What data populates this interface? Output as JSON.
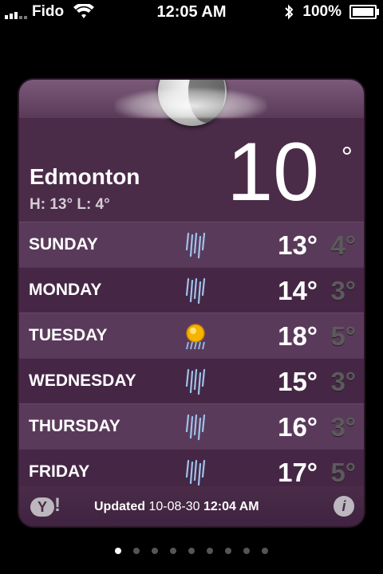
{
  "statusbar": {
    "carrier": "Fido",
    "time": "12:05 AM",
    "battery_percent": "100%",
    "battery_level": 1.0
  },
  "weather": {
    "city": "Edmonton",
    "current_temp": "10",
    "degree_symbol": "°",
    "hilo": "H: 13° L: 4°",
    "condition_icon": "moon-cloud-icon"
  },
  "forecast": [
    {
      "day": "SUNDAY",
      "icon": "rain-icon",
      "high": "13°",
      "low": "4°"
    },
    {
      "day": "MONDAY",
      "icon": "rain-icon",
      "high": "14°",
      "low": "3°"
    },
    {
      "day": "TUESDAY",
      "icon": "sun-rain-icon",
      "high": "18°",
      "low": "5°"
    },
    {
      "day": "WEDNESDAY",
      "icon": "rain-icon",
      "high": "15°",
      "low": "3°"
    },
    {
      "day": "THURSDAY",
      "icon": "rain-icon",
      "high": "16°",
      "low": "3°"
    },
    {
      "day": "FRIDAY",
      "icon": "rain-icon",
      "high": "17°",
      "low": "5°"
    }
  ],
  "footer": {
    "brand": "Y",
    "brand_bang": "!",
    "updated_label": "Updated",
    "updated_date": "10-08-30",
    "updated_time": "12:04 AM",
    "info": "i"
  },
  "pagination": {
    "total": 9,
    "active_index": 0
  },
  "colors": {
    "card_background": "#4a2c48",
    "row_light": "#5a3a5a",
    "row_dark": "#452745",
    "low_temp": "#5b5b5b"
  }
}
